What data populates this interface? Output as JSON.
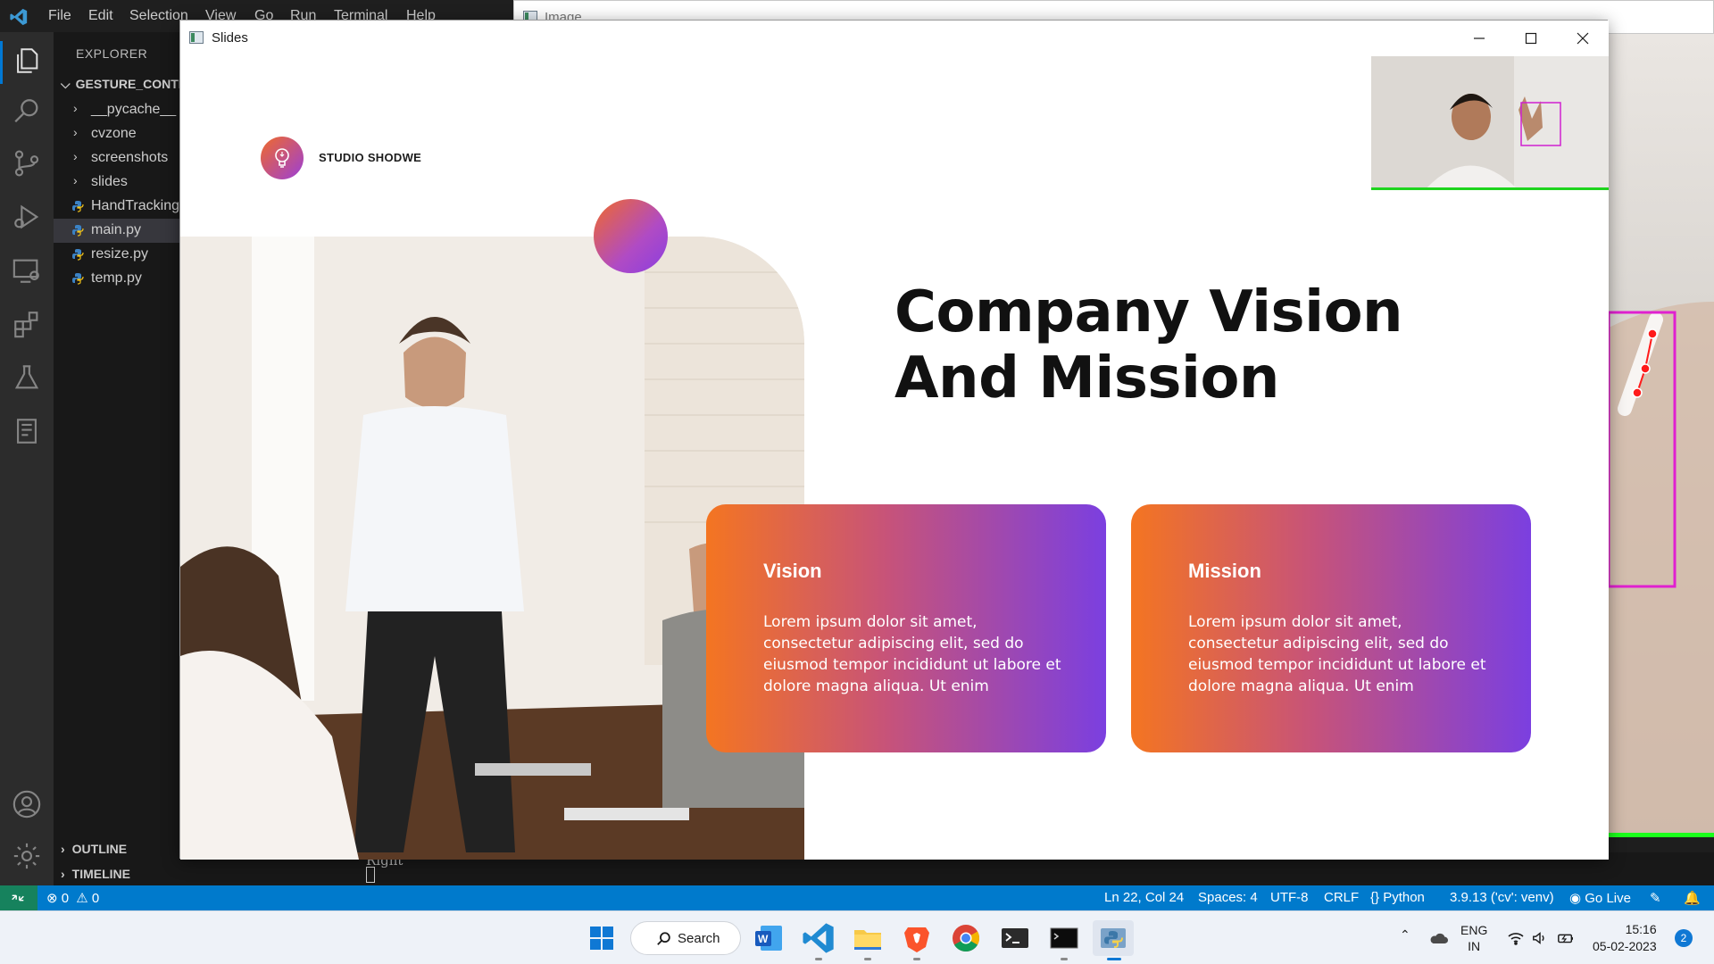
{
  "vscode": {
    "menu": [
      "File",
      "Edit",
      "Selection",
      "View",
      "Go",
      "Run",
      "Terminal",
      "Help"
    ],
    "explorer_header": "EXPLORER",
    "workspace": "GESTURE_CONTRO",
    "tree": [
      {
        "label": "__pycache__",
        "kind": "folder"
      },
      {
        "label": "cvzone",
        "kind": "folder"
      },
      {
        "label": "screenshots",
        "kind": "folder"
      },
      {
        "label": "slides",
        "kind": "folder"
      },
      {
        "label": "HandTracking",
        "kind": "python"
      },
      {
        "label": "main.py",
        "kind": "python",
        "selected": true
      },
      {
        "label": "resize.py",
        "kind": "python"
      },
      {
        "label": "temp.py",
        "kind": "python"
      }
    ],
    "outline": "OUTLINE",
    "timeline": "TIMELINE",
    "terminal_text": "Right",
    "status": {
      "errors": "0",
      "warnings": "0",
      "position": "Ln 22, Col 24",
      "spaces": "Spaces: 4",
      "encoding": "UTF-8",
      "eol": "CRLF",
      "language": "Python",
      "interpreter": "3.9.13 ('cv': venv)",
      "golive": "Go Live"
    }
  },
  "image_window": {
    "title": "Image"
  },
  "slides_window": {
    "title": "Slides",
    "brand": "STUDIO SHODWE",
    "headline_line1": "Company Vision",
    "headline_line2": "And Mission",
    "cards": [
      {
        "title": "Vision",
        "body": "Lorem ipsum dolor sit amet, consectetur adipiscing elit, sed do eiusmod tempor incididunt ut labore et dolore magna aliqua. Ut enim"
      },
      {
        "title": "Mission",
        "body": "Lorem ipsum dolor sit amet, consectetur adipiscing elit, sed do eiusmod tempor incididunt ut labore et dolore magna aliqua. Ut enim"
      }
    ],
    "colors": {
      "gradient_start": "#f47521",
      "gradient_end": "#7b3fe0"
    }
  },
  "taskbar": {
    "search_label": "Search",
    "apps": [
      "windows-start-icon",
      "search",
      "word-icon",
      "vscode-icon",
      "file-explorer-icon",
      "brave-icon",
      "chrome-icon",
      "terminal-icon",
      "cmd-icon",
      "python-icon"
    ],
    "lang_top": "ENG",
    "lang_bottom": "IN",
    "time": "15:16",
    "date": "05-02-2023",
    "notifications": "2"
  }
}
